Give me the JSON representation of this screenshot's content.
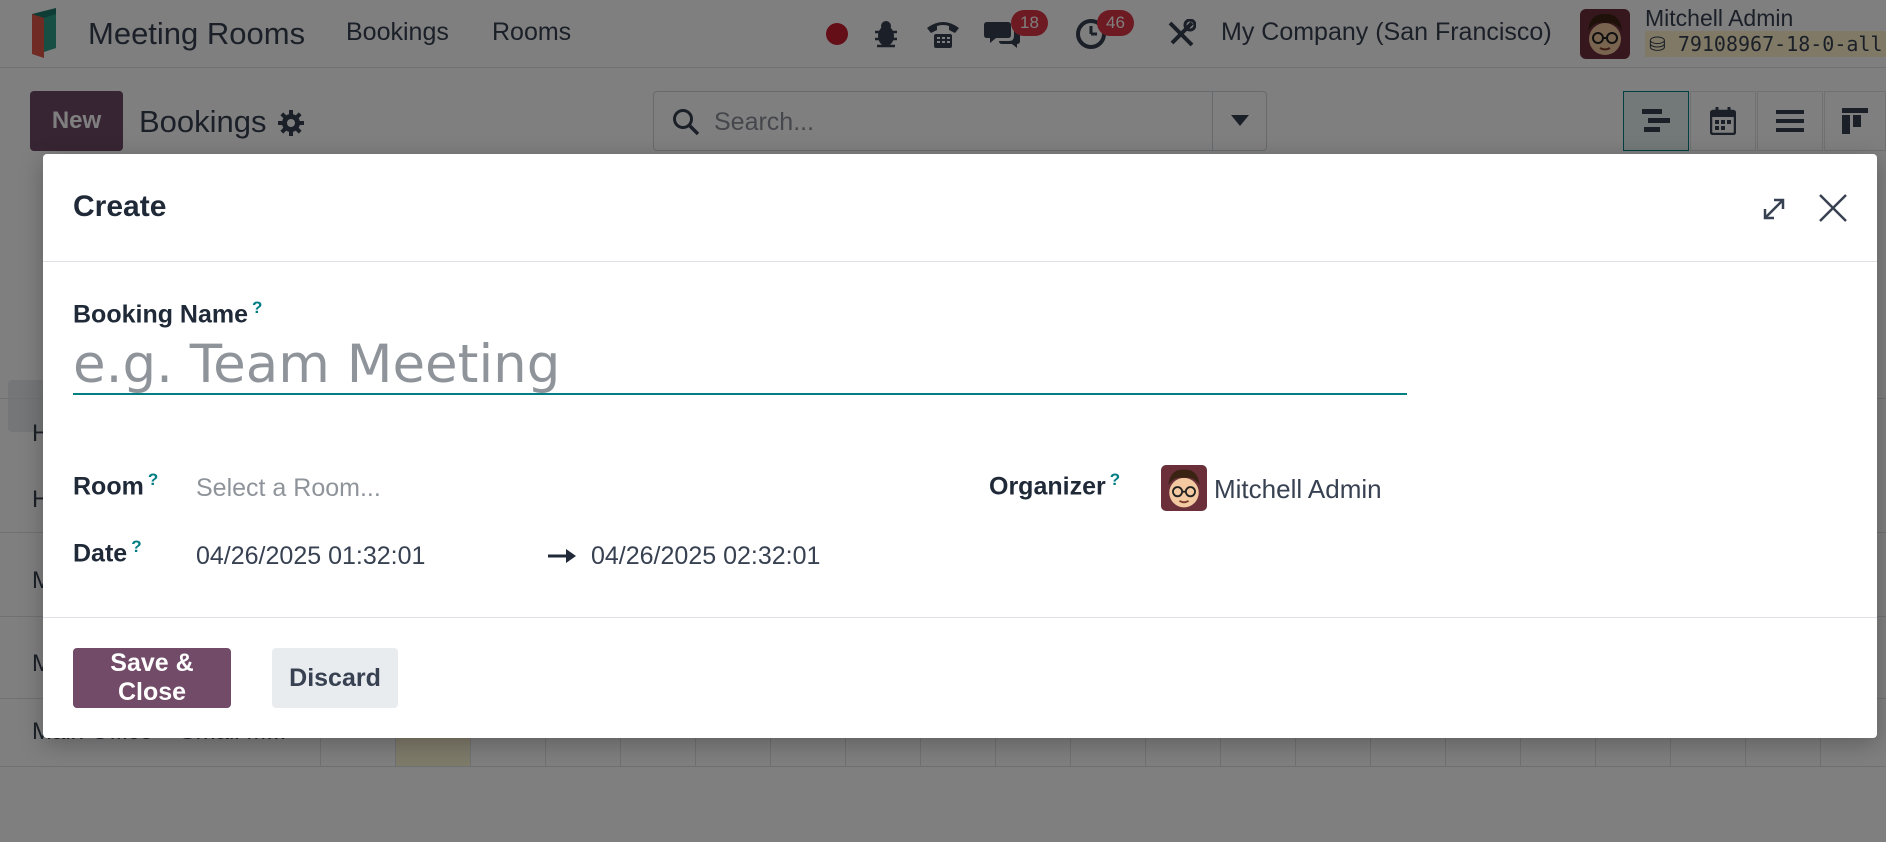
{
  "navbar": {
    "app_title": "Meeting Rooms",
    "menu": [
      "Bookings",
      "Rooms"
    ],
    "chat_badge": "18",
    "activity_badge": "46",
    "company": "My Company (San Francisco)",
    "user_name": "Mitchell Admin",
    "database": "79108967-18-0-all"
  },
  "control_panel": {
    "new_label": "New",
    "breadcrumb": "Bookings",
    "search_placeholder": "Search..."
  },
  "background": {
    "row_labels": [
      "H",
      "H",
      "M",
      "M",
      "Main Office – Small M..."
    ]
  },
  "dialog": {
    "title": "Create",
    "booking_name_label": "Booking Name",
    "booking_name_placeholder": "e.g. Team Meeting",
    "help_mark": "?",
    "room_label": "Room",
    "room_placeholder": "Select a Room...",
    "organizer_label": "Organizer",
    "organizer_value": "Mitchell Admin",
    "date_label": "Date",
    "date_start": "04/26/2025 01:32:01",
    "date_end": "04/26/2025 02:32:01",
    "save_label": "Save & Close",
    "discard_label": "Discard"
  },
  "colors": {
    "primary": "#714b67",
    "accent": "#017e84",
    "badge": "#dc3545"
  }
}
